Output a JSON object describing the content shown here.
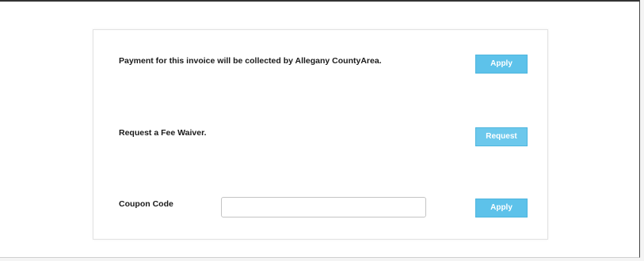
{
  "payment": {
    "message": "Payment for this invoice will be collected by Allegany CountyArea.",
    "button_label": "Apply"
  },
  "fee_waiver": {
    "message": "Request a Fee Waiver.",
    "button_label": "Request"
  },
  "coupon": {
    "label": "Coupon Code",
    "value": "",
    "placeholder": "",
    "button_label": "Apply"
  },
  "colors": {
    "button_background": "#5dc2ea",
    "button_text": "#ffffff",
    "page_background": "#ffffff"
  }
}
